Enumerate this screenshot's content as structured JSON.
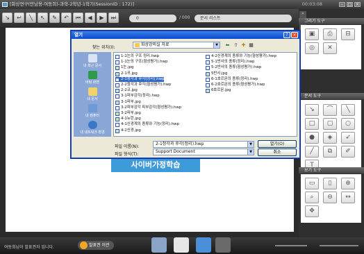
{
  "window": {
    "title": "[화상연구(만남용-여동희)-과학-2학년-1학기(SessionID : 172)]",
    "clock": "00:03:08"
  },
  "toolbar": {
    "page_value": "0",
    "page_total": "/ 000",
    "doc_select": "문서 리스트"
  },
  "right_panel": {
    "draw_tools": "그리기 도구",
    "doc_tools": "문서 도구",
    "view_tools": "보기 도구",
    "collapse": "»"
  },
  "canvas": {
    "banner": "사이버가정학습"
  },
  "dialog": {
    "title": "열기",
    "look_in_label": "찾는 위치(I):",
    "look_in_value": "화상강의실 자료",
    "places": [
      "내 최근 문서",
      "바탕 화면",
      "내 문서",
      "내 컴퓨터",
      "내 네트워크 환경"
    ],
    "files_col1": [
      "1-1눈의 구조 정리.hwp",
      "1-1눈의 구조(형성평가).hwp",
      "1눈.jpg",
      "2-1귀.jpg",
      "2-1청각과 후각(정리).hwp",
      "2-2청각과 후각(형성평가).hwp",
      "2-2코.jpg",
      "3-1피부감각(정리).hwp",
      "3-1피부.jpg",
      "3-2피부감각 피부감각(형성평가).hwp",
      "3-2피부.jpg",
      "4-1뉴런.jpg",
      "4-1신경계의 종류와 기능(정리).hwp",
      "4-2신경.jpg"
    ],
    "files_col2": [
      "4-2신경계의 종류와 기능(형성평가).hwp",
      "5-1반사의 종류(정리).hwp",
      "5-2반사의 종류(형성평가).hwp",
      "5반사.jpg",
      "6-1호르몬의 종류(정리).hwp",
      "6-2호르몬의 종류(형성평가).hwp",
      "6호르몬.jpg"
    ],
    "selected_index": 4,
    "filename_label": "파일 이름(N):",
    "filename_value": "2-1청각과 후각(정리).hwp",
    "filetype_label": "파일 형식(T):",
    "filetype_value": "Support Document",
    "open_button": "열기(O)",
    "cancel_button": "취소"
  },
  "bottom": {
    "status": "여동희님이 발표권자 입니다.",
    "presenter": "발표권 이관"
  }
}
